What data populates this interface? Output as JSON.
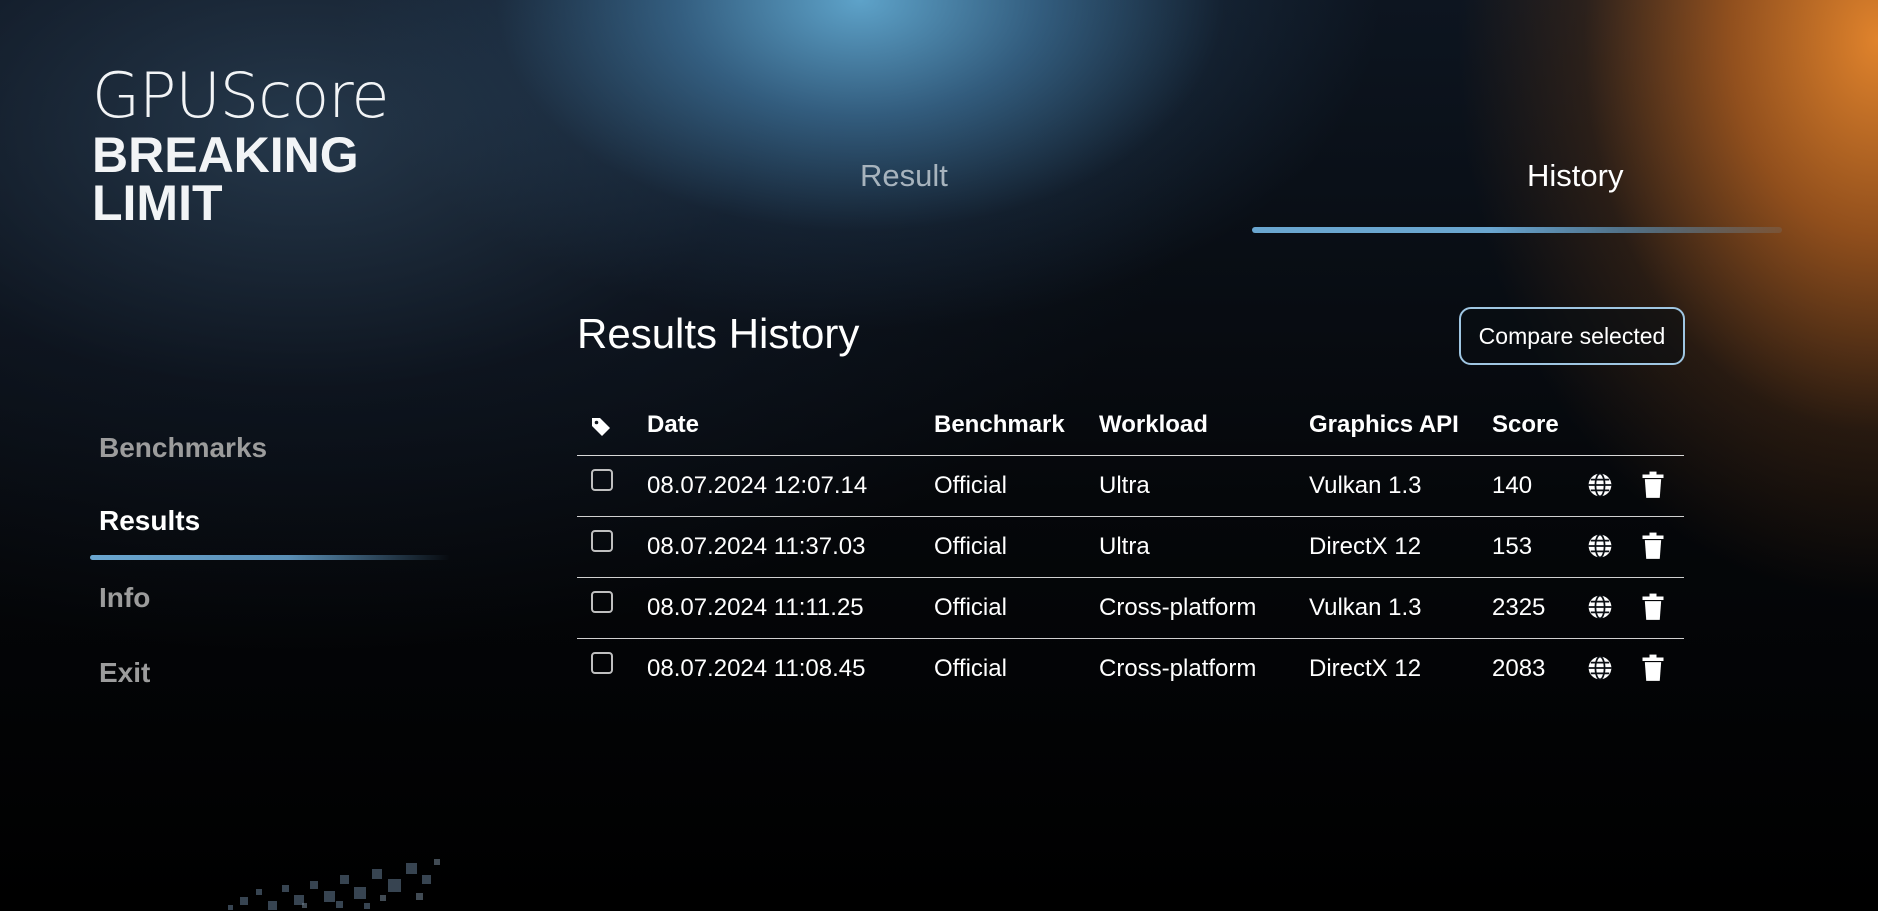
{
  "app": {
    "logo_main": "GPUScore",
    "logo_sub_1": "BREAKING",
    "logo_sub_2": "LIMIT"
  },
  "tabs": [
    {
      "label": "Result",
      "active": false
    },
    {
      "label": "History",
      "active": true
    }
  ],
  "sidebar": {
    "items": [
      {
        "label": "Benchmarks",
        "active": false
      },
      {
        "label": "Results",
        "active": true
      },
      {
        "label": "Info",
        "active": false
      },
      {
        "label": "Exit",
        "active": false
      }
    ]
  },
  "history": {
    "title": "Results History",
    "compare_label": "Compare selected",
    "columns": {
      "tag_icon": "tag-icon",
      "date": "Date",
      "benchmark": "Benchmark",
      "workload": "Workload",
      "api": "Graphics API",
      "score": "Score"
    },
    "rows": [
      {
        "date": "08.07.2024 12:07.14",
        "benchmark": "Official",
        "workload": "Ultra",
        "api": "Vulkan 1.3",
        "score": "140",
        "checked": false
      },
      {
        "date": "08.07.2024 11:37.03",
        "benchmark": "Official",
        "workload": "Ultra",
        "api": "DirectX 12",
        "score": "153",
        "checked": false
      },
      {
        "date": "08.07.2024 11:11.25",
        "benchmark": "Official",
        "workload": "Cross-platform",
        "api": "Vulkan 1.3",
        "score": "2325",
        "checked": false
      },
      {
        "date": "08.07.2024 11:08.45",
        "benchmark": "Official",
        "workload": "Cross-platform",
        "api": "DirectX 12",
        "score": "2083",
        "checked": false
      }
    ],
    "row_icons": [
      "globe-icon",
      "trash-icon"
    ]
  },
  "colors": {
    "accent_blue": "#6aa6d0",
    "accent_orange": "#e4852c",
    "button_border": "#9fc6e2"
  }
}
